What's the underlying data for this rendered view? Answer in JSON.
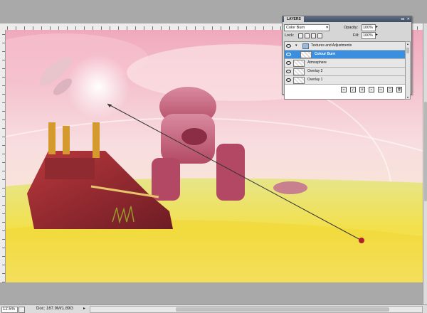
{
  "status": {
    "zoom": "12.5%",
    "doc": "Doc: 167.9M/1.89G"
  },
  "layers_panel": {
    "tab_label": "LAYERS",
    "blend_mode": "Color Burn",
    "opacity_label": "Opacity:",
    "opacity_value": "100%",
    "lock_label": "Lock:",
    "fill_label": "Fill:",
    "fill_value": "100%",
    "layers": [
      {
        "name": "Textures and Adjustments",
        "type": "group",
        "selected": false
      },
      {
        "name": "Colour Burn",
        "type": "layer",
        "selected": true
      },
      {
        "name": "Atmosphere",
        "type": "layer",
        "selected": false
      },
      {
        "name": "Overlay 2",
        "type": "layer",
        "selected": false
      },
      {
        "name": "Overlay 1",
        "type": "layer",
        "selected": false
      }
    ]
  },
  "colors": {
    "selection": "#3b8fe0",
    "sky_top": "#f4b6c4",
    "grass": "#f2e04a"
  }
}
